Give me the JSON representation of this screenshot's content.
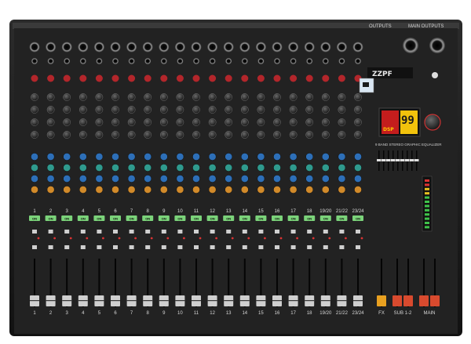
{
  "header": {
    "outputs_label": "OUTPUTS",
    "main_outputs_label": "MAIN OUTPUTS",
    "stereo_channel_labels": [
      "19/20",
      "21/22",
      "23/24"
    ]
  },
  "brand": {
    "logo_text": "ZZPF"
  },
  "dsp": {
    "display_number": "99",
    "display_label": "DSP",
    "eq_title": "9 BAND STEREO GRAPHIC EQUALIZER"
  },
  "channels": {
    "mono_count": 18,
    "labels": [
      "1",
      "2",
      "3",
      "4",
      "5",
      "6",
      "7",
      "8",
      "9",
      "10",
      "11",
      "12",
      "13",
      "14",
      "15",
      "16",
      "17",
      "18",
      "19/20",
      "21/22",
      "23/24"
    ],
    "on_label": "ON"
  },
  "bottom": {
    "fx_label": "FX",
    "sub_label": "SUB 1-2",
    "main_label": "MAIN"
  },
  "colors": {
    "chassis": "#1c1c1c",
    "panel": "#2a2a2a",
    "knob_red": "#b3262b",
    "knob_blue": "#2d6fb8",
    "knob_teal": "#2f9a8e",
    "knob_orange": "#d18a2a",
    "button_green": "#7bd37a",
    "fader_cap": "#cfcfcf",
    "fx_cap": "#e8a020",
    "main_cap": "#d84a2e"
  }
}
